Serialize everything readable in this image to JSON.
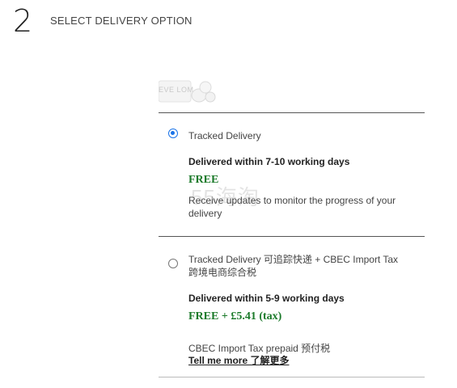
{
  "step": {
    "number": "2",
    "title": "SELECT DELIVERY OPTION"
  },
  "product": {
    "thumbnail_text": "EVE LOM"
  },
  "options": [
    {
      "selected": true,
      "name": "Tracked Delivery",
      "timing": "Delivered within 7-10 working days",
      "price": "FREE",
      "note": "Receive updates to monitor the progress of your delivery"
    },
    {
      "selected": false,
      "name": "Tracked Delivery 可追踪快递 + CBEC Import Tax",
      "name_line2": "跨境电商综合税",
      "timing": "Delivered within 5-9 working days",
      "price": "FREE + £5.41 (tax)",
      "note": "CBEC Import Tax prepaid 预付税",
      "link": "Tell me more 了解更多"
    }
  ],
  "watermark": "55海淘",
  "colors": {
    "accent": "#1a73e8",
    "price": "#1b7a2a",
    "divider": "#555555"
  }
}
